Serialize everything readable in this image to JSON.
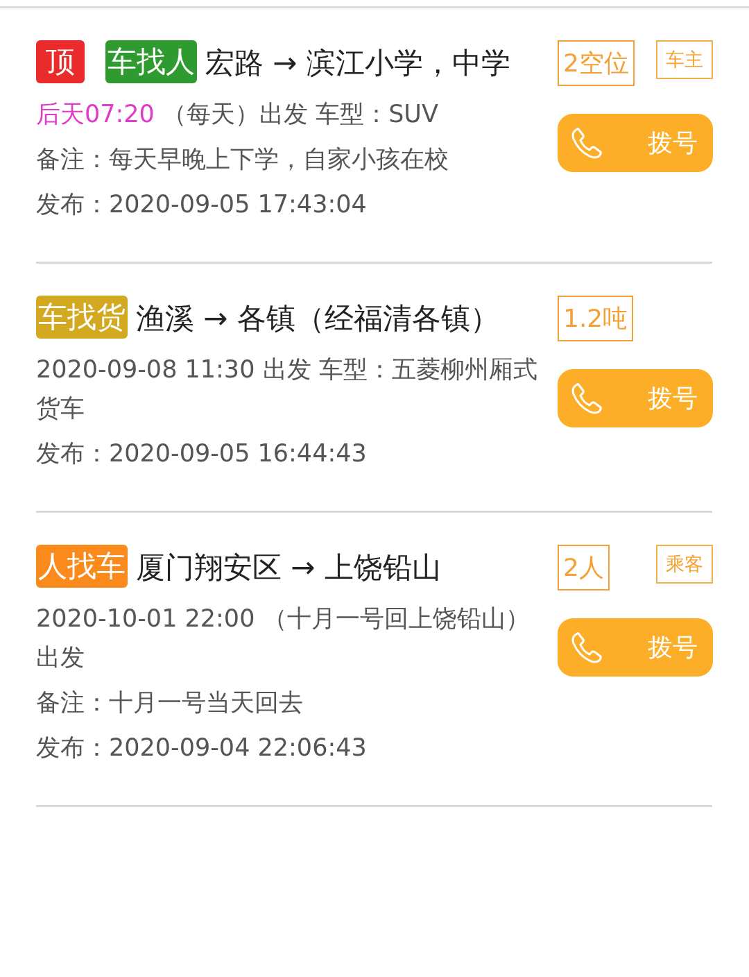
{
  "posts": [
    {
      "tags": [
        {
          "label": "顶",
          "kind": "top"
        },
        {
          "label": "车找人",
          "kind": "car_seeks_people"
        }
      ],
      "route": "宏路 → 滨江小学，中学",
      "capacity": "2空位",
      "role": "车主",
      "call_button": "拨号",
      "lines": [
        {
          "highlight": "后天07:20",
          "text": " （每天）出发 车型：SUV"
        },
        {
          "text": "备注：每天早晚上下学，自家小孩在校"
        },
        {
          "text": "发布：2020-09-05 17:43:04"
        }
      ]
    },
    {
      "tags": [
        {
          "label": "车找货",
          "kind": "car_seeks_cargo"
        }
      ],
      "route": "渔溪 → 各镇（经福清各镇）",
      "capacity": "1.2吨",
      "call_button": "拨号",
      "lines": [
        {
          "text": "2020-09-08 11:30 出发 车型：五菱柳州厢式货车"
        },
        {
          "text": "发布：2020-09-05 16:44:43"
        }
      ]
    },
    {
      "tags": [
        {
          "label": "人找车",
          "kind": "people_seek_car"
        }
      ],
      "route": "厦门翔安区 → 上饶铅山",
      "capacity": "2人",
      "role": "乘客",
      "call_button": "拨号",
      "lines": [
        {
          "text": "2020-10-01 22:00 （十月一号回上饶铅山）出发"
        },
        {
          "text": "备注：十月一号当天回去"
        },
        {
          "text": "发布：2020-09-04 22:06:43"
        }
      ]
    }
  ]
}
